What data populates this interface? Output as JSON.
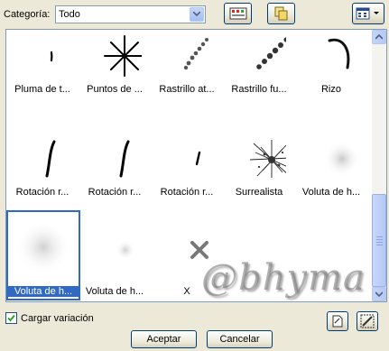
{
  "category": {
    "label": "Categoría:",
    "value": "Todo"
  },
  "brushes": [
    {
      "label": "Pluma de t...",
      "icon": "pen-stroke-icon"
    },
    {
      "label": "Puntos de ...",
      "icon": "star-points-icon"
    },
    {
      "label": "Rastrillo at...",
      "icon": "rake-dots-icon"
    },
    {
      "label": "Rastrillo fu...",
      "icon": "rake-heavy-icon"
    },
    {
      "label": "Rizo",
      "icon": "curl-icon"
    },
    {
      "label": "Rotación r...",
      "icon": "rotation-stroke-icon"
    },
    {
      "label": "Rotación r...",
      "icon": "rotation-stroke-icon"
    },
    {
      "label": "Rotación r...",
      "icon": "rotation-small-icon"
    },
    {
      "label": "Surrealista",
      "icon": "surreal-splat-icon"
    },
    {
      "label": "Voluta de h...",
      "icon": "smoke-icon"
    },
    {
      "label": "Voluta de h...",
      "icon": "smoke-large-icon"
    },
    {
      "label": "Voluta de h...",
      "icon": "smoke-small-icon"
    },
    {
      "label": "X",
      "icon": "x-brush-icon"
    }
  ],
  "selected_index": 10,
  "watermark": "@bhyma",
  "load_variation": {
    "label": "Cargar variación",
    "checked": true
  },
  "buttons": {
    "accept": "Aceptar",
    "cancel": "Cancelar"
  }
}
